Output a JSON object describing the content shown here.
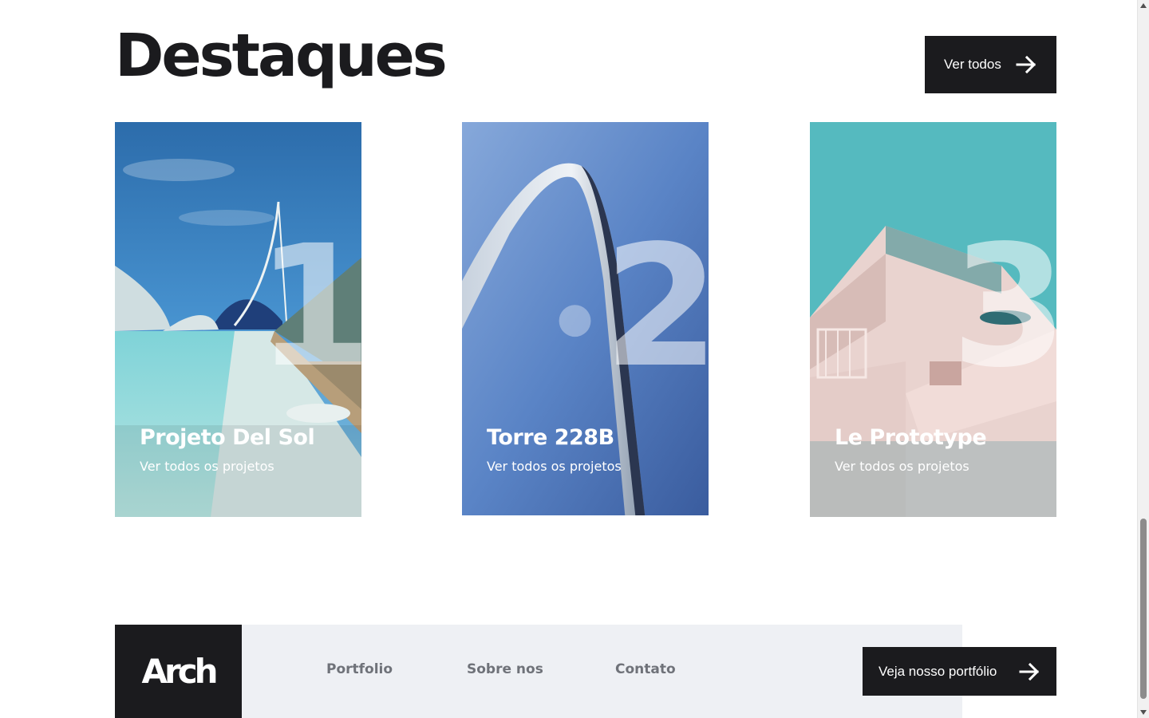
{
  "section": {
    "title": "Destaques",
    "view_all_label": "Ver todos"
  },
  "cards": [
    {
      "number": "1",
      "title": "Projeto Del Sol",
      "subtitle": "Ver todos os projetos"
    },
    {
      "number": "2",
      "title": "Torre 228B",
      "subtitle": "Ver todos os projetos"
    },
    {
      "number": "3",
      "title": "Le Prototype",
      "subtitle": "Ver todos os projetos"
    }
  ],
  "footer": {
    "logo": "Arch",
    "links": [
      "Portfolio",
      "Sobre nos",
      "Contato"
    ],
    "cta_label": "Veja nosso portfólio"
  },
  "colors": {
    "dark": "#1b1b1e",
    "footer_bg": "#eef0f4",
    "link": "#6f7279"
  }
}
